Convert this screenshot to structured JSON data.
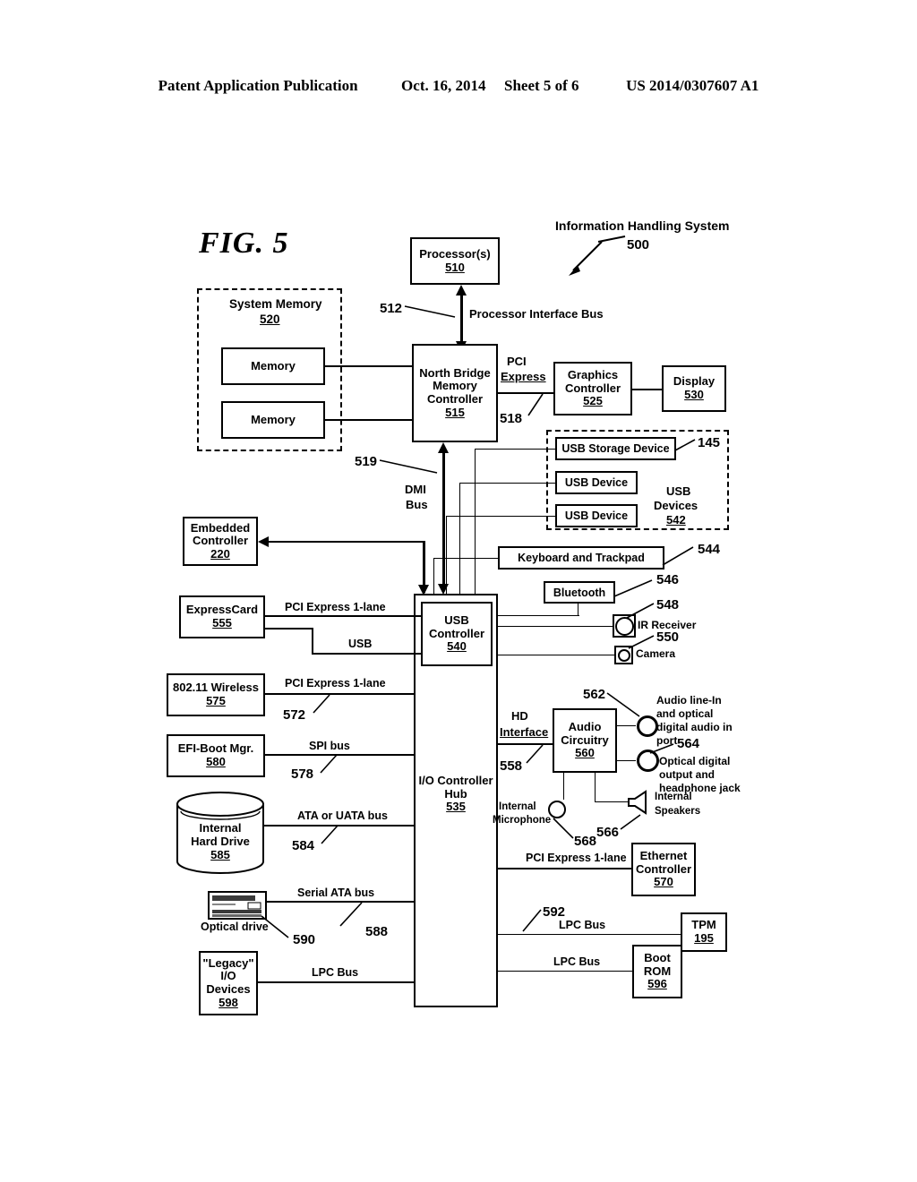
{
  "header": {
    "publication": "Patent Application Publication",
    "date": "Oct. 16, 2014",
    "sheet": "Sheet 5 of 6",
    "patent_number": "US 2014/0307607 A1"
  },
  "figure": {
    "title": "FIG. 5",
    "system_title": "Information Handling System",
    "system_ref": "500"
  },
  "blocks": {
    "processor": {
      "line1": "Processor(s)",
      "num": "510"
    },
    "system_memory": {
      "line1": "System Memory",
      "num": "520"
    },
    "memory_a": {
      "line1": "Memory"
    },
    "memory_b": {
      "line1": "Memory"
    },
    "north_bridge": {
      "line1": "North Bridge",
      "line2": "Memory",
      "line3": "Controller",
      "num": "515"
    },
    "graphics_controller": {
      "line1": "Graphics",
      "line2": "Controller",
      "num": "525"
    },
    "display": {
      "line1": "Display",
      "num": "530"
    },
    "usb_storage_device": {
      "line1": "USB Storage Device"
    },
    "usb_device_1": {
      "line1": "USB Device"
    },
    "usb_device_2": {
      "line1": "USB Device"
    },
    "usb_devices_group": {
      "line1": "USB",
      "line2": "Devices",
      "num": "542"
    },
    "keyboard_trackpad": {
      "line1": "Keyboard and Trackpad"
    },
    "bluetooth": {
      "line1": "Bluetooth"
    },
    "embedded_controller": {
      "line1": "Embedded",
      "line2": "Controller",
      "num": "220"
    },
    "expresscard": {
      "line1": "ExpressCard",
      "num": "555"
    },
    "wireless": {
      "line1": "802.11 Wireless",
      "num": "575"
    },
    "efi_boot_mgr": {
      "line1": "EFI-Boot Mgr.",
      "num": "580"
    },
    "internal_hard_drive": {
      "line1": "Internal",
      "line2": "Hard Drive",
      "num": "585"
    },
    "legacy_io_devices": {
      "line1": "\"Legacy\"",
      "line2": "I/O",
      "line3": "Devices",
      "num": "598"
    },
    "usb_controller": {
      "line1": "USB",
      "line2": "Controller",
      "num": "540"
    },
    "io_controller_hub": {
      "line1": "I/O Controller",
      "line2": "Hub",
      "num": "535"
    },
    "audio_circuitry": {
      "line1": "Audio",
      "line2": "Circuitry",
      "num": "560"
    },
    "ethernet_controller": {
      "line1": "Ethernet",
      "line2": "Controller",
      "num": "570"
    },
    "tpm": {
      "line1": "TPM",
      "num": "195"
    },
    "boot_rom": {
      "line1": "Boot",
      "line2": "ROM",
      "num": "596"
    }
  },
  "bus_labels": {
    "processor_interface_bus": "Processor Interface Bus",
    "pci_express_line1": "PCI",
    "pci_express_line2": "Express",
    "dmi_line1": "DMI",
    "dmi_line2": "Bus",
    "pcie_1lane_expresscard": "PCI Express 1-lane",
    "usb": "USB",
    "pcie_1lane_wireless": "PCI Express 1-lane",
    "spi_bus": "SPI bus",
    "ata_uata_bus": "ATA or UATA bus",
    "serial_ata_bus": "Serial ATA bus",
    "lpc_bus_legacy": "LPC Bus",
    "hd_interface_line1": "HD",
    "hd_interface_line2": "Interface",
    "pcie_1lane_ethernet": "PCI Express 1-lane",
    "lpc_bus_tpm": "LPC Bus",
    "lpc_bus_bootrom": "LPC Bus"
  },
  "peripheral_labels": {
    "ir_receiver": "IR Receiver",
    "camera": "Camera",
    "optical_drive": "Optical drive",
    "audio_in_port": "Audio line-In and optical digital audio in port",
    "audio_out_jack": "Optical digital output and headphone jack",
    "internal_microphone": "Internal Microphone",
    "internal_speakers": "Internal Speakers"
  },
  "reference_numerals": {
    "r512": "512",
    "r518": "518",
    "r519": "519",
    "r145": "145",
    "r544": "544",
    "r546": "546",
    "r548": "548",
    "r550": "550",
    "r572": "572",
    "r578": "578",
    "r584": "584",
    "r588": "588",
    "r590": "590",
    "r558": "558",
    "r562": "562",
    "r564": "564",
    "r566": "566",
    "r568": "568",
    "r592": "592"
  }
}
